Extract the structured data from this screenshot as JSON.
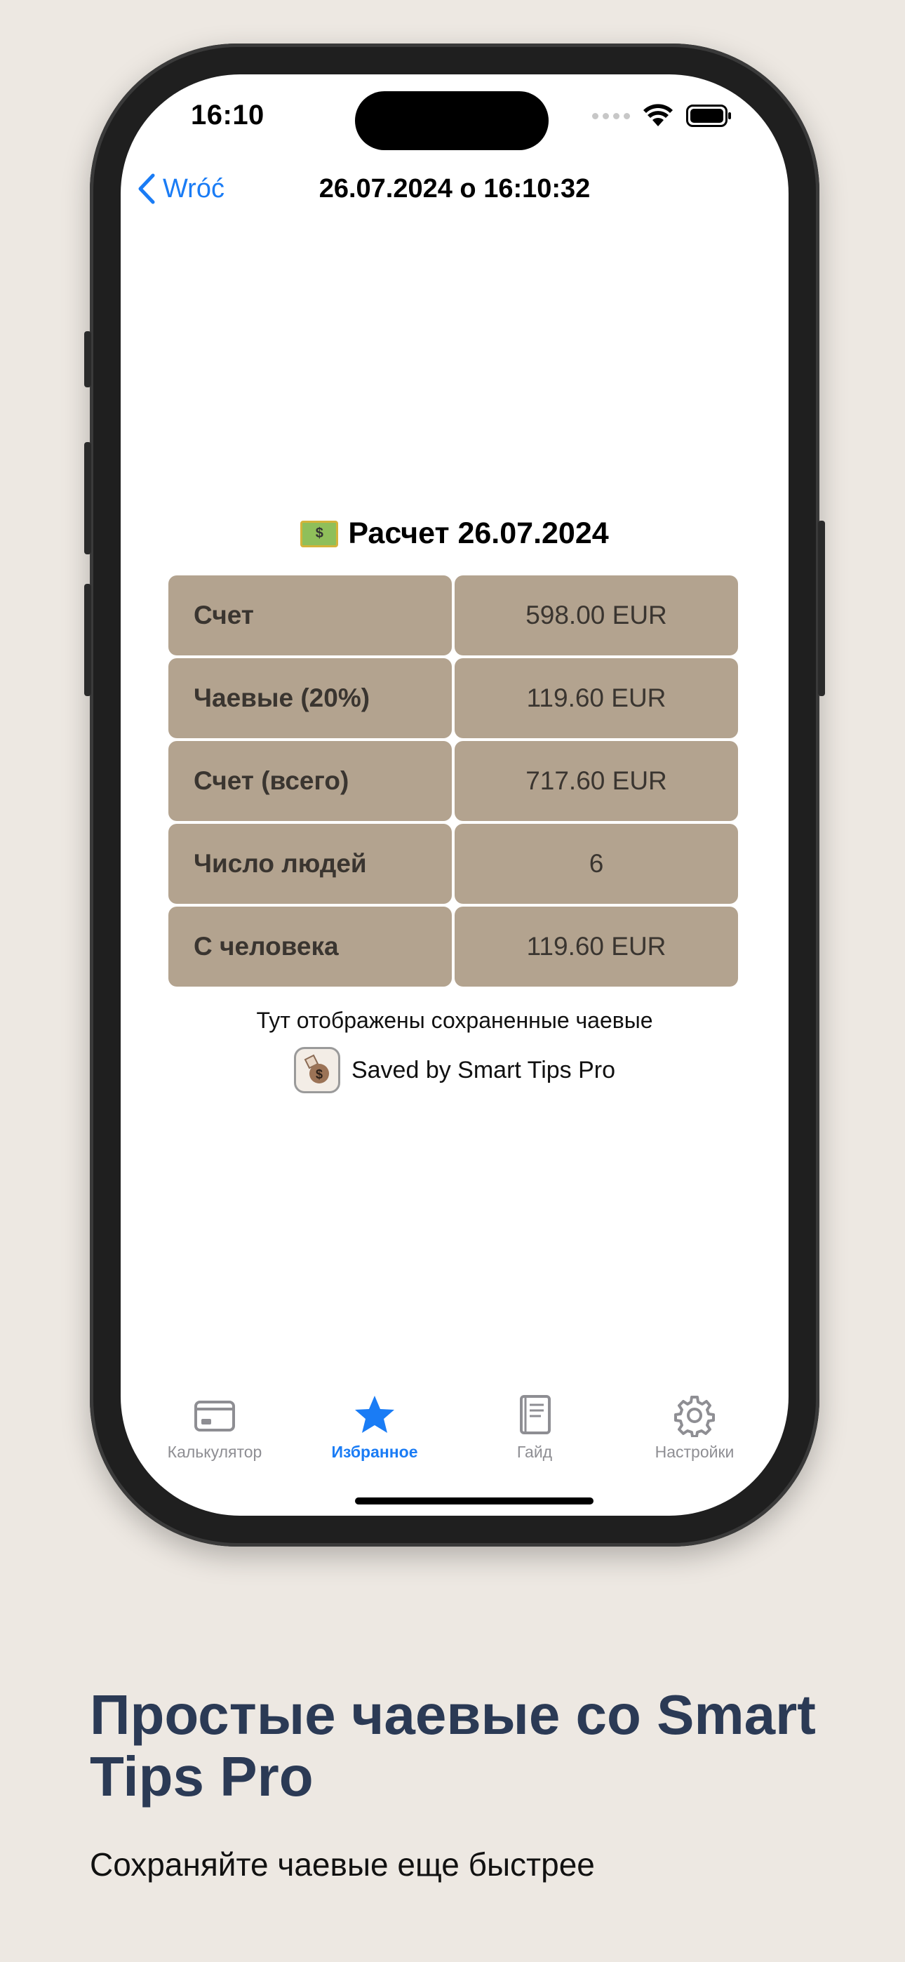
{
  "status_bar": {
    "time": "16:10"
  },
  "nav": {
    "back_label": "Wróć",
    "title": "26.07.2024 o 16:10:32"
  },
  "receipt": {
    "title": "Расчет 26.07.2024",
    "money_icon_symbol": "$",
    "rows": [
      {
        "label": "Счет",
        "value": "598.00 EUR"
      },
      {
        "label": "Чаевые (20%)",
        "value": "119.60 EUR"
      },
      {
        "label": "Счет (всего)",
        "value": "717.60 EUR"
      },
      {
        "label": "Число людей",
        "value": "6"
      },
      {
        "label": "С человека",
        "value": "119.60 EUR"
      }
    ],
    "note": "Тут отображены сохраненные чаевые",
    "saved_by": "Saved by Smart Tips Pro"
  },
  "tabbar": {
    "tabs": [
      {
        "label": "Калькулятор",
        "icon": "credit-card-icon",
        "active": false
      },
      {
        "label": "Избранное",
        "icon": "star-icon",
        "active": true
      },
      {
        "label": "Гайд",
        "icon": "book-icon",
        "active": false
      },
      {
        "label": "Настройки",
        "icon": "gear-icon",
        "active": false
      }
    ]
  },
  "colors": {
    "accent": "#1a7cf5",
    "cell_background": "#b3a38f",
    "page_background": "#ede8e2",
    "headline": "#2b3a55"
  },
  "caption": {
    "headline": "Простые чаевые со Smart Tips Pro",
    "subline": "Сохраняйте чаевые еще быстрее"
  }
}
